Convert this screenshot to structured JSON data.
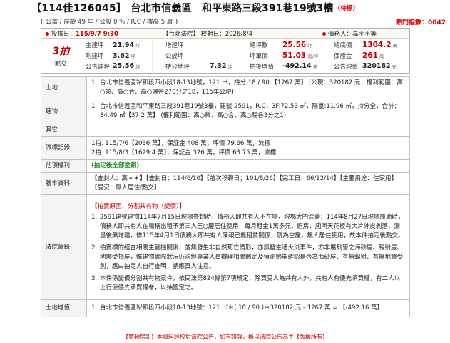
{
  "header": {
    "case_no": "【114佳126045】",
    "city_district": "台北市信義區",
    "address": "和平東路三段391巷19號3樓",
    "status_badge": "(待標)",
    "sub_info": "{ 公寓 / 屋齡 49 年 / 公設 0 % / R.C / 樓高 5 層 }",
    "hot_index": "熱門指數：0042"
  },
  "info": {
    "bid_date_label": "投標日：",
    "bid_date": "115/9/7 9:30",
    "court": "【台北法院】 校對日：2026/8/4",
    "creditor": "債務人：高＊＊等",
    "auction_round": "3拍",
    "auction_type": "點交",
    "col1": [
      {
        "label": "主建坪",
        "value": "21.94",
        "unit": "坪"
      },
      {
        "label": "附建坪",
        "value": "3.62",
        "unit": "坪"
      },
      {
        "label": "公告建坪",
        "value": "25.56",
        "unit": "坪"
      }
    ],
    "col2": [
      {
        "label": "增建坪",
        "value": "",
        "unit": ""
      },
      {
        "label": "公設坪",
        "value": "",
        "unit": ""
      },
      {
        "label": "持分地坪",
        "value": "7.32",
        "unit": "坪"
      }
    ],
    "col3": [
      {
        "label": "總坪數",
        "value": "25.56",
        "unit": "坪"
      },
      {
        "label": "坪單價",
        "value": "51.03",
        "unit": "萬/坪"
      },
      {
        "label": "拍後增值",
        "value": "-492.14",
        "unit": "萬"
      }
    ],
    "col4": [
      {
        "label": "總底價",
        "value": "1304.2",
        "unit": "萬"
      },
      {
        "label": "保證金",
        "value": "261",
        "unit": "萬"
      },
      {
        "label": "公告現值",
        "value": "320182",
        "unit": "元"
      }
    ]
  },
  "rows": {
    "land": {
      "label": "土地",
      "lines": [
        {
          "num": "1.",
          "text": "台北市信義區犁和段四小段18-13地號，121 ㎡，持分 18 / 90 【1267 萬】 (公現：320182 元，權利範圍：高○榮、高○合、高○賜各270分之18，115年公現)"
        }
      ]
    },
    "building": {
      "label": "建物",
      "lines": [
        {
          "num": "1.",
          "text": "台北市信義區和平東路三段391巷19號3樓，建號 2591，R.C，3F:72.53 ㎡，陽臺:11.96 ㎡，持分全，合計：84.49 ㎡【37.2 萬】 (權利範圍：高○榮、高○合、高○賜各3分之1)"
        }
      ]
    },
    "other": {
      "label": "其它",
      "text": ""
    },
    "history": {
      "label": "流標記錄",
      "lines": [
        "1拍. 115/7/6【2036 萬】，保証金 408 萬，坪價 79.66 萬，流標",
        "2拍. 115/8/3【1629.4 萬】，保証金 326 萬，坪價 63.75 萬，流標"
      ]
    },
    "rights": {
      "label": "他項權利",
      "text": "(拍定後全部塗銷)"
    },
    "transcript": {
      "label": "謄本資料",
      "lines": [
        "【查封人：高＊＊】【查封日：114/6/10】【前次移轉日；101/8/26】【完工日：66/12/14】【主要用途：住家用】【屋況：無人居住/點交】"
      ]
    },
    "notes": {
      "label": "法院筆錄",
      "reason": "【拍賣原因：分割共有物（變價）】",
      "items": [
        {
          "num": "1.",
          "text": "2591建號建物114年7月15日現場查封時，債務人即共有人不在場，現場大門深鎖；114年8月27日現場履勘時，債務人即共有人在場稱出租予第三人王○慶居住使用，每月租金1萬多元，廚房、廁所天花板有大片外皮剝落，測量後無增建，惟115年4月1日債務人即共有人陳報已無租賃關係，現為空屋，無人居住使用，故本件拍定後點交。"
        },
        {
          "num": "2.",
          "text": "拍賣標的經查相關主管機關後，並無發生非自然死亡情形，亦無發生過火災事件，亦非屬列管之海砂屋、輻射屋、地震受損屋，惟建物實際狀況仍須經專業人員辦理相關鑑定及偵測始能確認是否為海砂屋、有無輻射、有無地震受創，應由拍定人自行查明，請應買人注意。"
        },
        {
          "num": "3.",
          "text": "本件係變價分割共有物案件，依民法第824條第7項規定，除買受人為共有人外，共有人有優先承買權，有二人以上行使優先承買權者，以抽籤定之。"
        }
      ]
    },
    "land_value": {
      "label": "土地增值",
      "lines": [
        {
          "num": "1.",
          "text": "台北市信義區犁和段四小段18-13地號：121 ㎡＊( 18 / 90 )＊320182 元 - 1267 萬 = 【-492.16 萬】"
        }
      ]
    }
  },
  "footer": {
    "text": "【寬頻房訊】本資料經校對法院公告，如有錯誤，概以法院公告為主【版權所有】"
  }
}
